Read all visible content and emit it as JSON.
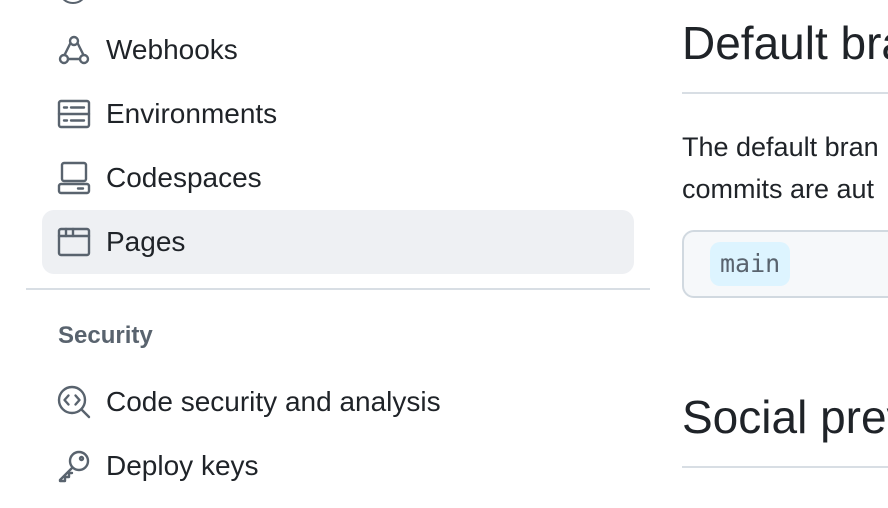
{
  "sidebar": {
    "items": [
      {
        "label": "Webhooks",
        "icon": "webhook-icon"
      },
      {
        "label": "Environments",
        "icon": "server-icon"
      },
      {
        "label": "Codespaces",
        "icon": "codespaces-icon"
      },
      {
        "label": "Pages",
        "icon": "browser-icon",
        "selected": true
      }
    ],
    "security_section": {
      "heading": "Security",
      "items": [
        {
          "label": "Code security and analysis",
          "icon": "codescan-icon"
        },
        {
          "label": "Deploy keys",
          "icon": "key-icon"
        }
      ]
    }
  },
  "main": {
    "default_branch": {
      "title": "Default bra",
      "description_line1": "The default bran",
      "description_line2": "commits are aut",
      "branch_name": "main"
    },
    "social_preview": {
      "title": "Social prev"
    }
  },
  "colors": {
    "selected_bg": "#eef0f3",
    "text": "#1f2328",
    "muted": "#59636e",
    "branch_pill_bg": "#ddf4ff"
  }
}
